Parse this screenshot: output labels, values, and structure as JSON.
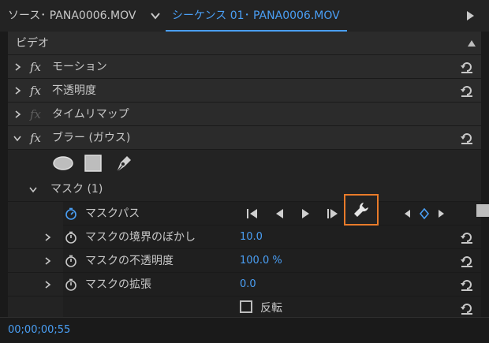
{
  "tabs": {
    "source_label": "ソース･ PANA0006.MOV",
    "sequence_label": "シーケンス 01･ PANA0006.MOV"
  },
  "header": {
    "video_label": "ビデオ"
  },
  "effects": {
    "motion": "モーション",
    "opacity": "不透明度",
    "time_remap": "タイムリマップ",
    "blur": "ブラー (ガウス)"
  },
  "mask": {
    "title": "マスク (1)",
    "path_label": "マスクパス",
    "feather_label": "マスクの境界のぼかし",
    "feather_value": "10.0",
    "opacity_label": "マスクの不透明度",
    "opacity_value": "100.0 %",
    "expansion_label": "マスクの拡張",
    "expansion_value": "0.0",
    "inverted_label": "反転"
  },
  "status": {
    "timecode": "00;00;00;55"
  },
  "colors": {
    "accent": "#4a9ff5",
    "highlight": "#e97b2a"
  }
}
